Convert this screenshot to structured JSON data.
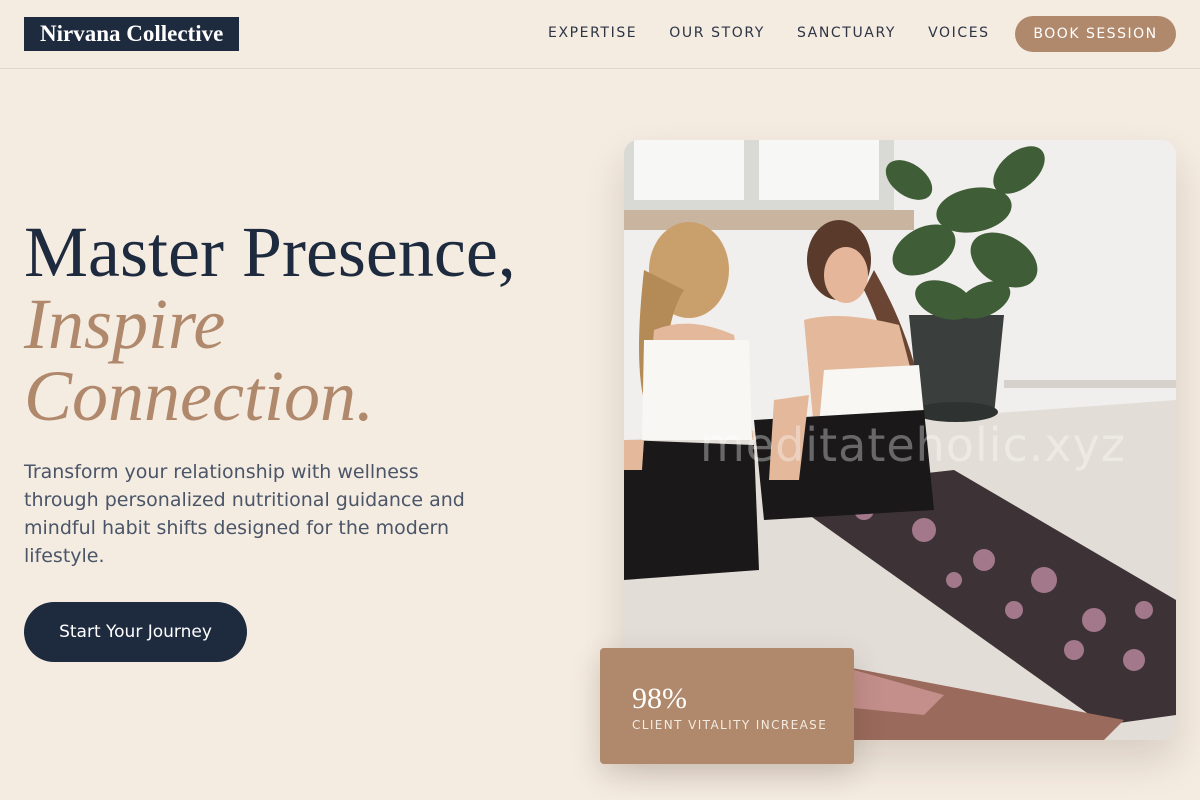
{
  "brand": {
    "name": "Nirvana Collective"
  },
  "nav": {
    "items": [
      {
        "label": "EXPERTISE"
      },
      {
        "label": "OUR STORY"
      },
      {
        "label": "SANCTUARY"
      },
      {
        "label": "VOICES"
      }
    ],
    "cta_label": "BOOK SESSION"
  },
  "hero": {
    "headline_line1": "Master Presence,",
    "headline_line2": "Inspire",
    "headline_line3": "Connection.",
    "subtext": "Transform your relationship with wellness through personalized nutritional guidance and mindful habit shifts designed for the modern lifestyle.",
    "cta_label": "Start Your Journey"
  },
  "image": {
    "watermark": "meditateholic.xyz"
  },
  "stat": {
    "value": "98%",
    "label": "CLIENT VITALITY INCREASE"
  },
  "colors": {
    "background": "#f4ebe1",
    "navy": "#1e2a3e",
    "accent": "#b0886b"
  }
}
